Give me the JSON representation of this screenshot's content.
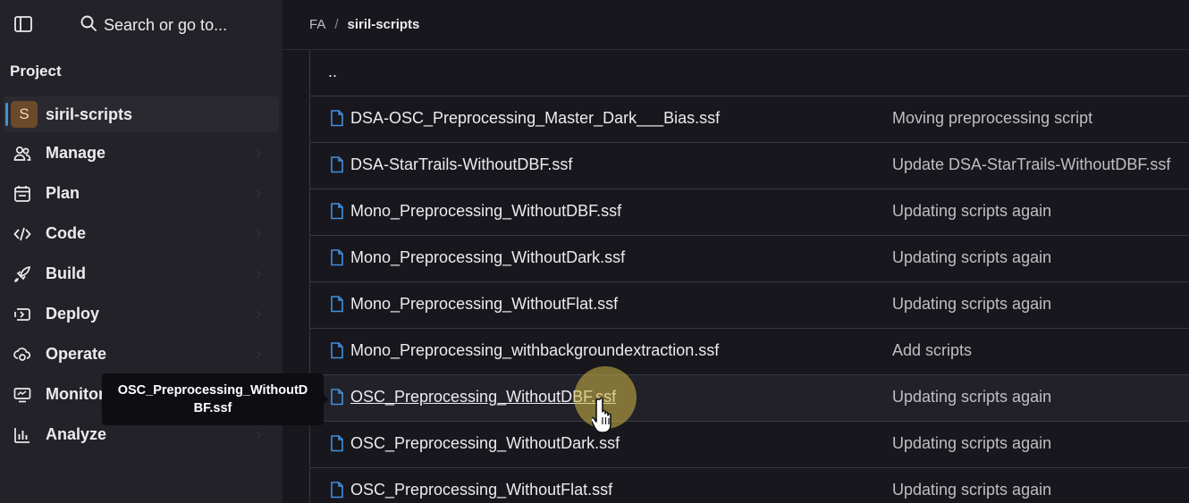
{
  "sidebar": {
    "search_label": "Search or go to...",
    "section_title": "Project",
    "project": {
      "avatar_letter": "S",
      "name": "siril-scripts"
    },
    "items": [
      {
        "label": "Manage",
        "icon": "users-icon"
      },
      {
        "label": "Plan",
        "icon": "plan-icon"
      },
      {
        "label": "Code",
        "icon": "code-icon"
      },
      {
        "label": "Build",
        "icon": "rocket-icon"
      },
      {
        "label": "Deploy",
        "icon": "deploy-icon"
      },
      {
        "label": "Operate",
        "icon": "cloud-gear-icon"
      },
      {
        "label": "Monitor",
        "icon": "monitor-icon"
      },
      {
        "label": "Analyze",
        "icon": "chart-icon"
      }
    ]
  },
  "breadcrumb": {
    "root": "FA",
    "separator": "/",
    "current": "siril-scripts"
  },
  "files": {
    "parent": "..",
    "rows": [
      {
        "name": "DSA-OSC_Preprocessing_Master_Dark___Bias.ssf",
        "commit": "Moving preprocessing script"
      },
      {
        "name": "DSA-StarTrails-WithoutDBF.ssf",
        "commit": "Update DSA-StarTrails-WithoutDBF.ssf"
      },
      {
        "name": "Mono_Preprocessing_WithoutDBF.ssf",
        "commit": "Updating scripts again"
      },
      {
        "name": "Mono_Preprocessing_WithoutDark.ssf",
        "commit": "Updating scripts again"
      },
      {
        "name": "Mono_Preprocessing_WithoutFlat.ssf",
        "commit": "Updating scripts again"
      },
      {
        "name": "Mono_Preprocessing_withbackgroundextraction.ssf",
        "commit": "Add scripts"
      },
      {
        "name": "OSC_Preprocessing_WithoutDBF.ssf",
        "commit": "Updating scripts again"
      },
      {
        "name": "OSC_Preprocessing_WithoutDark.ssf",
        "commit": "Updating scripts again"
      },
      {
        "name": "OSC_Preprocessing_WithoutFlat.ssf",
        "commit": "Updating scripts again"
      }
    ]
  },
  "tooltip": {
    "line1": "OSC_Preprocessing_WithoutD",
    "line2": "BF.ssf"
  },
  "colors": {
    "accent": "#428fdc",
    "sidebar_bg": "#232228",
    "page_bg": "#18171d",
    "file_icon": "#428fdc"
  }
}
